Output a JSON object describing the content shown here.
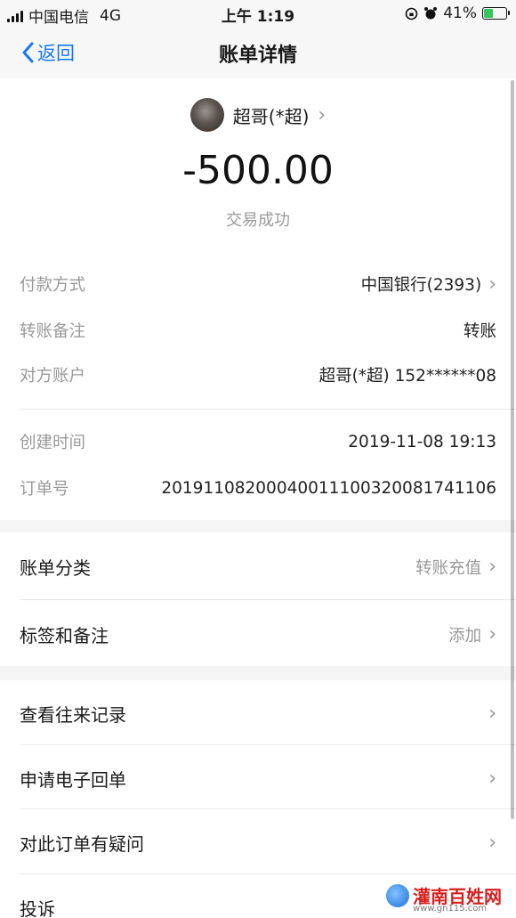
{
  "status_bar": {
    "carrier": "中国电信",
    "network": "4G",
    "time": "上午 1:19",
    "battery": "41%",
    "battery_level": 0.41
  },
  "nav": {
    "back_label": "返回",
    "title": "账单详情"
  },
  "payee": {
    "name": "超哥(*超)"
  },
  "amount": "-500.00",
  "status_text": "交易成功",
  "details": [
    {
      "label": "付款方式",
      "value": "中国银行(2393)"
    },
    {
      "label": "转账备注",
      "value": "转账"
    },
    {
      "label": "对方账户",
      "value": "超哥(*超) 152******08"
    },
    {
      "label": "创建时间",
      "value": "2019-11-08 19:13"
    },
    {
      "label": "订单号",
      "value": "20191108200040011100320081741106"
    }
  ],
  "category": {
    "label": "账单分类",
    "value": "转账充值"
  },
  "tags": {
    "label": "标签和备注",
    "value": "添加"
  },
  "actions": [
    {
      "label": "查看往来记录"
    },
    {
      "label": "申请电子回单"
    },
    {
      "label": "对此订单有疑问"
    },
    {
      "label": "投诉"
    }
  ],
  "watermark": {
    "name": "灌南百姓网",
    "url": "www.gn115.com"
  },
  "colors": {
    "accent": "#1677ff",
    "muted": "#999999",
    "battery": "#34c759"
  }
}
